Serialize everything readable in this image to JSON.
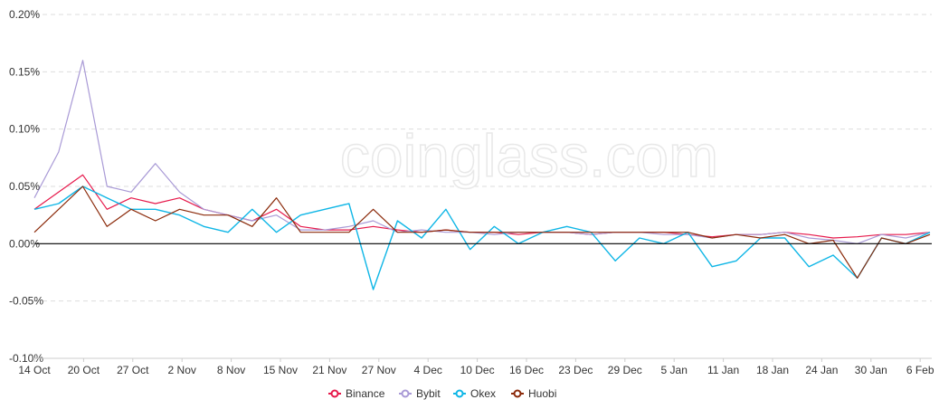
{
  "watermark": "coinglass.com",
  "chart_data": {
    "type": "line",
    "title": "",
    "xlabel": "",
    "ylabel": "",
    "ylim": [
      -0.1,
      0.2
    ],
    "y_unit": "%",
    "y_ticks": [
      {
        "value": 0.2,
        "label": "0.20%"
      },
      {
        "value": 0.15,
        "label": "0.15%"
      },
      {
        "value": 0.1,
        "label": "0.10%"
      },
      {
        "value": 0.05,
        "label": "0.05%"
      },
      {
        "value": 0.0,
        "label": "0.00%"
      },
      {
        "value": -0.05,
        "label": "-0.05%"
      },
      {
        "value": -0.1,
        "label": "-0.10%"
      }
    ],
    "x_ticks": [
      "14 Oct",
      "20 Oct",
      "27 Oct",
      "2 Nov",
      "8 Nov",
      "15 Nov",
      "21 Nov",
      "27 Nov",
      "4 Dec",
      "10 Dec",
      "16 Dec",
      "23 Dec",
      "29 Dec",
      "5 Jan",
      "11 Jan",
      "18 Jan",
      "24 Jan",
      "30 Jan",
      "6 Feb"
    ],
    "x": [
      "14 Oct",
      "17 Oct",
      "20 Oct",
      "23 Oct",
      "27 Oct",
      "30 Oct",
      "2 Nov",
      "5 Nov",
      "8 Nov",
      "11 Nov",
      "15 Nov",
      "18 Nov",
      "21 Nov",
      "24 Nov",
      "27 Nov",
      "30 Nov",
      "4 Dec",
      "7 Dec",
      "10 Dec",
      "13 Dec",
      "16 Dec",
      "19 Dec",
      "23 Dec",
      "26 Dec",
      "29 Dec",
      "1 Jan",
      "5 Jan",
      "8 Jan",
      "11 Jan",
      "14 Jan",
      "18 Jan",
      "21 Jan",
      "24 Jan",
      "27 Jan",
      "30 Jan",
      "3 Feb",
      "6 Feb",
      "9 Feb"
    ],
    "grid": true,
    "zero_line": true,
    "legend_position": "bottom-center",
    "series": [
      {
        "name": "Binance",
        "color": "#e6194b",
        "marker": "circle",
        "values": [
          0.03,
          0.045,
          0.06,
          0.03,
          0.04,
          0.035,
          0.04,
          0.03,
          0.025,
          0.02,
          0.03,
          0.015,
          0.012,
          0.012,
          0.015,
          0.012,
          0.01,
          0.012,
          0.01,
          0.01,
          0.008,
          0.01,
          0.01,
          0.008,
          0.01,
          0.01,
          0.01,
          0.008,
          0.006,
          0.008,
          0.008,
          0.01,
          0.008,
          0.005,
          0.006,
          0.008,
          0.008,
          0.01
        ]
      },
      {
        "name": "Bybit",
        "color": "#a99ad6",
        "marker": "circle",
        "values": [
          0.04,
          0.08,
          0.16,
          0.05,
          0.045,
          0.07,
          0.045,
          0.03,
          0.025,
          0.02,
          0.025,
          0.012,
          0.012,
          0.015,
          0.02,
          0.01,
          0.012,
          0.01,
          0.01,
          0.008,
          0.01,
          0.01,
          0.01,
          0.008,
          0.01,
          0.01,
          0.008,
          0.008,
          0.005,
          0.008,
          0.008,
          0.01,
          0.005,
          0.003,
          0.0,
          0.008,
          0.005,
          0.01
        ]
      },
      {
        "name": "Okex",
        "color": "#0fb6e6",
        "marker": "circle",
        "values": [
          0.03,
          0.035,
          0.05,
          0.04,
          0.03,
          0.03,
          0.025,
          0.015,
          0.01,
          0.03,
          0.01,
          0.025,
          0.03,
          0.035,
          -0.04,
          0.02,
          0.005,
          0.03,
          -0.005,
          0.015,
          0.0,
          0.01,
          0.015,
          0.01,
          -0.015,
          0.005,
          0.0,
          0.01,
          -0.02,
          -0.015,
          0.005,
          0.005,
          -0.02,
          -0.01,
          -0.03,
          0.005,
          0.0,
          0.01
        ]
      },
      {
        "name": "Huobi",
        "color": "#8b2a0a",
        "marker": "circle",
        "values": [
          0.01,
          0.03,
          0.05,
          0.015,
          0.03,
          0.02,
          0.03,
          0.025,
          0.025,
          0.015,
          0.04,
          0.01,
          0.01,
          0.01,
          0.03,
          0.01,
          0.01,
          0.012,
          0.01,
          0.01,
          0.01,
          0.01,
          0.01,
          0.01,
          0.01,
          0.01,
          0.01,
          0.01,
          0.005,
          0.008,
          0.005,
          0.008,
          0.0,
          0.003,
          -0.03,
          0.005,
          0.0,
          0.008
        ]
      }
    ]
  }
}
